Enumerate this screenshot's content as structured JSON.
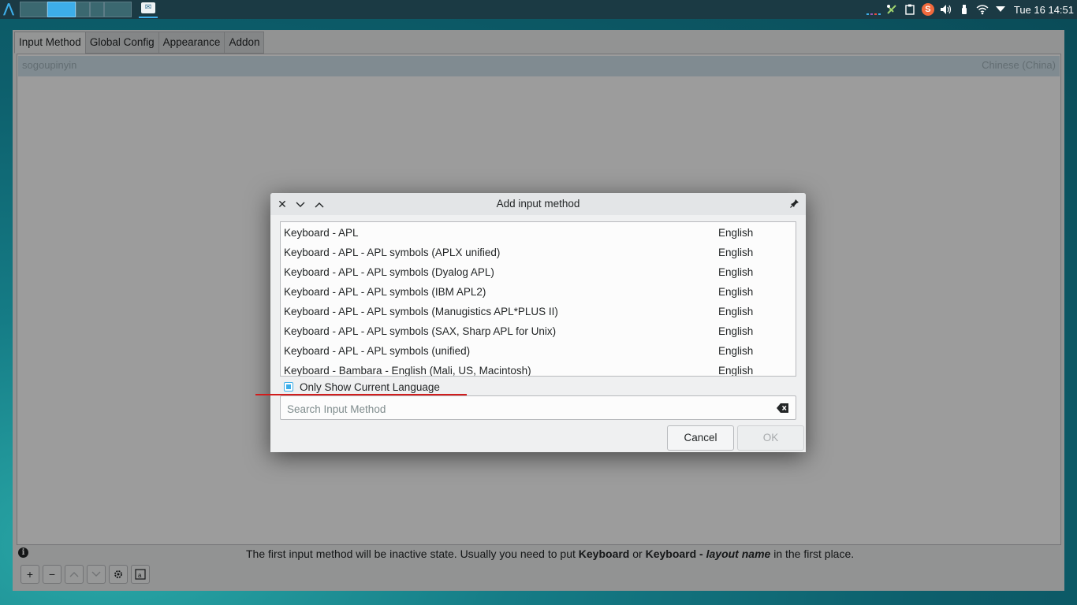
{
  "top_panel": {
    "launcher_icon": "app-launcher-icon",
    "pager_desktops": 4,
    "active_desktop": 2,
    "task_icon": "fcitx-config-icon",
    "tray_icons": [
      "keyboard-layout-icon",
      "network-tool-icon",
      "clipboard-icon",
      "sogou-icon",
      "volume-icon",
      "usb-device-icon",
      "wifi-icon",
      "arrow-expand-icon"
    ],
    "sogou_letter": "S",
    "clock": "Tue 16  14:51"
  },
  "main": {
    "tabs": [
      {
        "label": "Input Method",
        "active": true
      },
      {
        "label": "Global Config",
        "active": false
      },
      {
        "label": "Appearance",
        "active": false
      },
      {
        "label": "Addon",
        "active": false
      }
    ],
    "im_list": [
      {
        "name": "sogoupinyin",
        "language": "Chinese (China)"
      }
    ],
    "info": {
      "p1": "The first input method will be inactive state. Usually you need to put ",
      "b1": "Keyboard",
      "p2": " or ",
      "b2": "Keyboard - ",
      "b3": "layout name",
      "p3": " in the first place."
    },
    "toolbar": {
      "add": "+",
      "remove": "−",
      "up": "︿",
      "down": "﹀",
      "configure_icon": "gear-icon",
      "keyboard_icon": "keyboard-layout-icon"
    }
  },
  "dialog": {
    "title": "Add input method",
    "items": [
      {
        "name": "Keyboard - APL",
        "language": "English"
      },
      {
        "name": "Keyboard - APL - APL symbols (APLX unified)",
        "language": "English"
      },
      {
        "name": "Keyboard - APL - APL symbols (Dyalog APL)",
        "language": "English"
      },
      {
        "name": "Keyboard - APL - APL symbols (IBM APL2)",
        "language": "English"
      },
      {
        "name": "Keyboard - APL - APL symbols (Manugistics APL*PLUS II)",
        "language": "English"
      },
      {
        "name": "Keyboard - APL - APL symbols (SAX, Sharp APL for Unix)",
        "language": "English"
      },
      {
        "name": "Keyboard - APL - APL symbols (unified)",
        "language": "English"
      },
      {
        "name": "Keyboard - Bambara - English (Mali, US, Macintosh)",
        "language": "English"
      }
    ],
    "only_current_language": {
      "label": "Only Show Current Language",
      "checked": true
    },
    "search": {
      "placeholder": "Search Input Method",
      "value": ""
    },
    "cancel_label": "Cancel",
    "ok_label": "OK"
  },
  "colors": {
    "accent": "#3daee9",
    "annotation": "#d11d1d"
  }
}
